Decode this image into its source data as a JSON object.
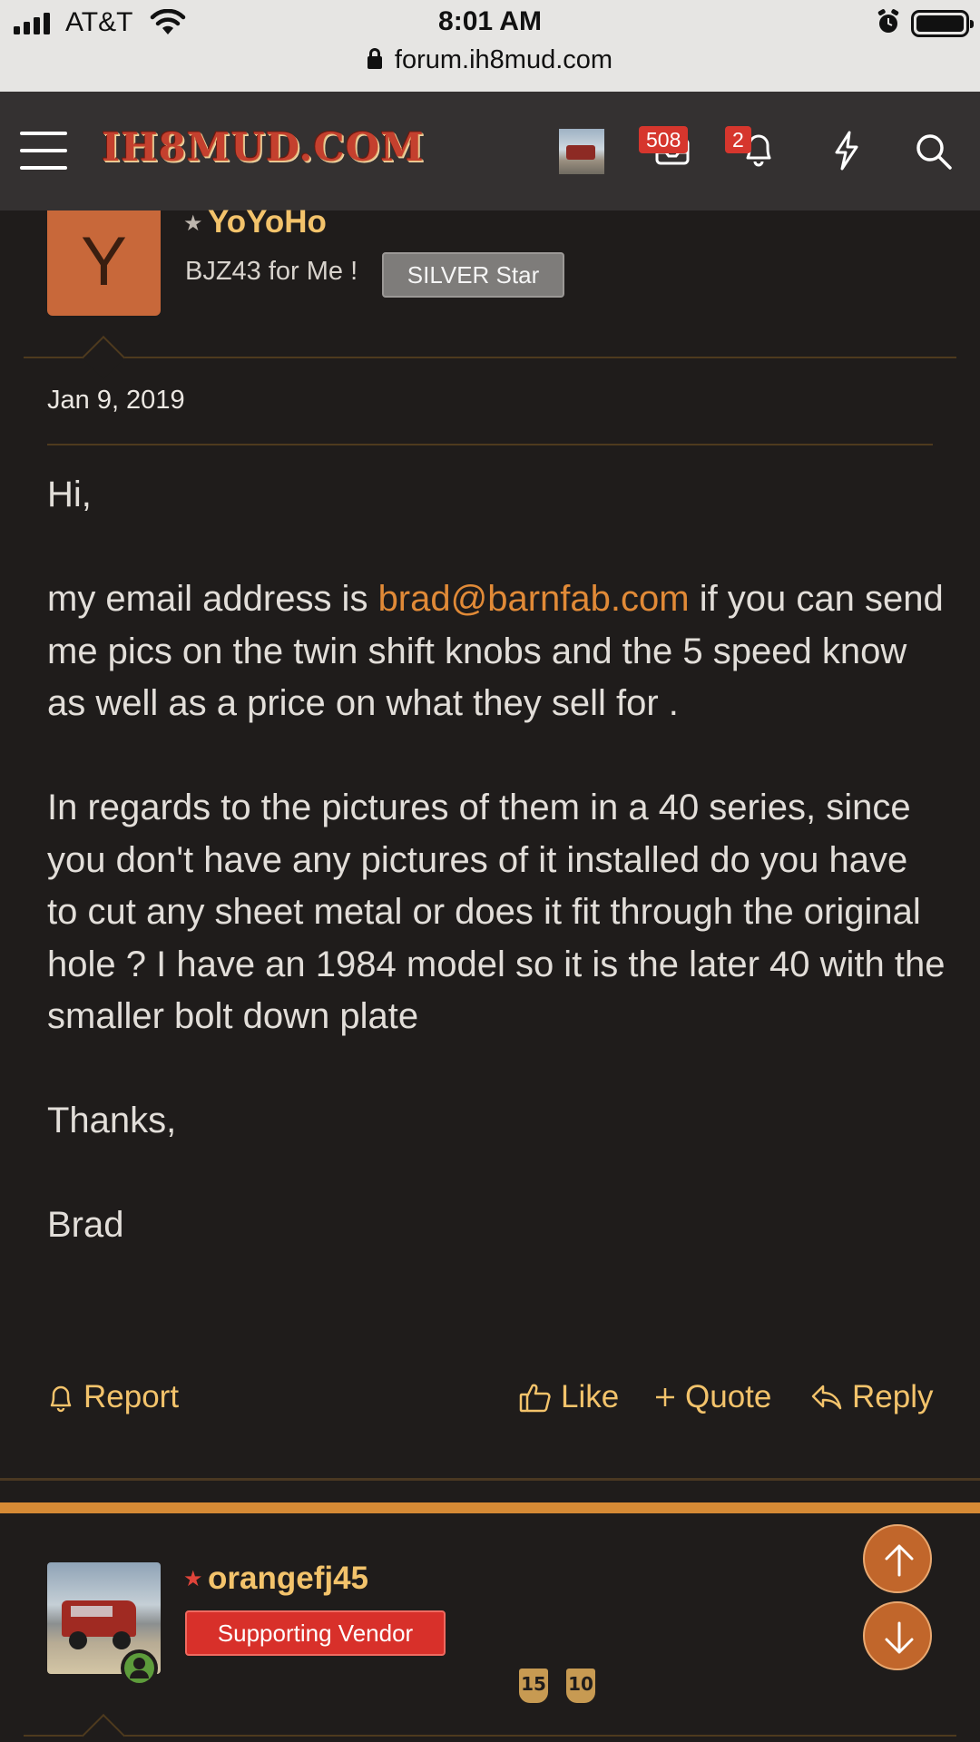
{
  "status_bar": {
    "carrier": "AT&T",
    "time": "8:01 AM",
    "url": "forum.ih8mud.com"
  },
  "header": {
    "logo_text": "IH8MUD.COM",
    "inbox_count": "508",
    "alerts_count": "2"
  },
  "post1": {
    "avatar_letter": "Y",
    "username": "YoYoHo",
    "user_title": "BJZ43 for Me !",
    "user_badge": "SILVER Star",
    "date": "Jan 9, 2019",
    "body": {
      "greeting": "Hi,",
      "p2_before": "my email address is ",
      "p2_email": "brad@barnfab.com",
      "p2_after": " if you can send me pics on the twin shift knobs and the 5 speed know as well as a price on what they sell for .",
      "p3": "In regards to the pictures of them in a 40 series, since you don't have any pictures of it installed do you have to cut any sheet metal or does it fit through the original hole ? I have an 1984 model so it is the later 40 with the smaller bolt down plate",
      "thanks": "Thanks,",
      "signature": "Brad"
    },
    "actions": {
      "report": "Report",
      "like": "Like",
      "quote": "Quote",
      "reply": "Reply"
    }
  },
  "post2": {
    "username": "orangefj45",
    "user_badge": "Supporting Vendor",
    "trophy_1": "15",
    "trophy_2": "10"
  },
  "colors": {
    "accent": "#f3c36b",
    "link": "#e18a37",
    "fab": "#c1662b",
    "vendor_red": "#d8302a"
  }
}
